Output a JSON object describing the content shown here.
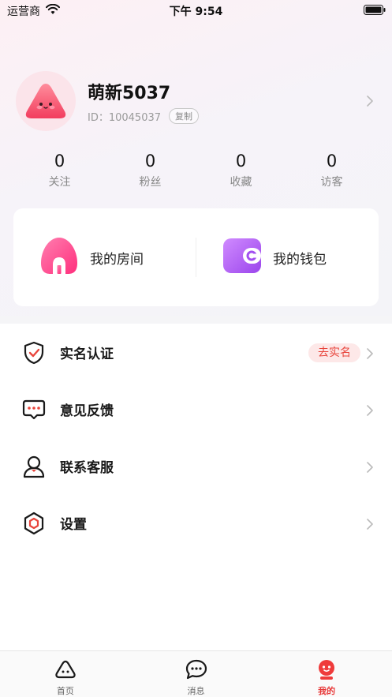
{
  "status_bar": {
    "carrier": "运营商",
    "time": "下午 9:54"
  },
  "profile": {
    "nickname": "萌新5037",
    "uid": "ID：10045037",
    "copy_label": "复制"
  },
  "stats": [
    {
      "value": "0",
      "label": "关注"
    },
    {
      "value": "0",
      "label": "粉丝"
    },
    {
      "value": "0",
      "label": "收藏"
    },
    {
      "value": "0",
      "label": "访客"
    }
  ],
  "card": {
    "room_label": "我的房间",
    "wallet_label": "我的钱包"
  },
  "menu": [
    {
      "label": "实名认证",
      "icon": "shield-check-icon",
      "badge": "去实名"
    },
    {
      "label": "意见反馈",
      "icon": "chat-bubble-icon"
    },
    {
      "label": "联系客服",
      "icon": "person-icon"
    },
    {
      "label": "设置",
      "icon": "hexagon-settings-icon"
    }
  ],
  "tabs": [
    {
      "label": "首页",
      "icon": "home-face-icon",
      "active": false
    },
    {
      "label": "消息",
      "icon": "message-icon",
      "active": false
    },
    {
      "label": "我的",
      "icon": "mine-avatar-icon",
      "active": true
    }
  ],
  "colors": {
    "accent": "#e8453c",
    "room_gradient": "#ff3d8b",
    "wallet_gradient": "#b45cf0"
  }
}
